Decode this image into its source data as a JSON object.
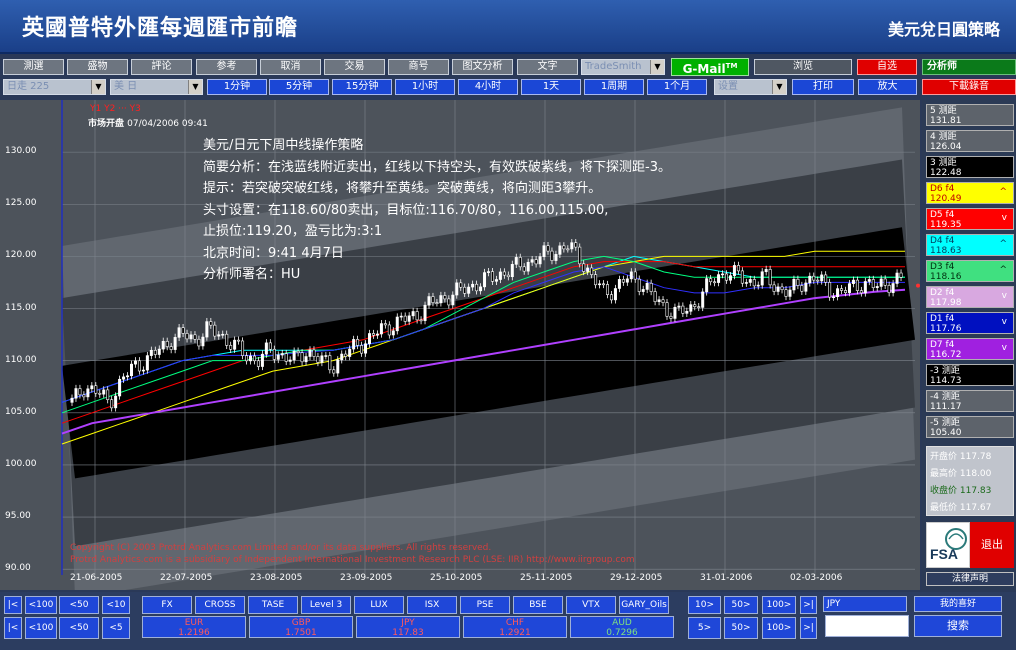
{
  "header": {
    "title": "英國普特外匯每週匯市前瞻",
    "subtitle": "美元兌日圓策略"
  },
  "toolbar1": {
    "buttons": [
      "測選",
      "盛物",
      "評论",
      "参考",
      "取消",
      "交易",
      "商号",
      "图文分析",
      "文字"
    ],
    "trade_select": "TradeSmith",
    "gmail": "G-Mail",
    "gmail_sup": "TM",
    "btn_browse": "浏览",
    "btn_auto": "自选",
    "analyst": "分析师"
  },
  "toolbar2": {
    "select1": "日走 225",
    "select2": "美 日",
    "intervals": [
      "1分钟",
      "5分钟",
      "15分钟",
      "1小时",
      "4小时",
      "1天",
      "1周期",
      "1个月"
    ],
    "select3": "设置",
    "print": "打印",
    "zoom": "放大",
    "download": "下載錄音"
  },
  "chart": {
    "legend_top": "Y1 Y2 ··· Y3",
    "open_time_label": "市场开盘",
    "open_time": "07/04/2006 09:41",
    "note_lines": [
      "美元/日元下周中线操作策略",
      "简要分析：在浅蓝线附近卖出，红线以下持空头，有效跌破紫线，将下探测距-3。",
      "提示：若突破突破红线，将攀升至黄线。突破黄线，将向测距3攀升。",
      "头寸设置：在118.60/80卖出，目标位:116.70/80，116.00,115.00,",
      "止损位:119.20，盈亏比为:3:1",
      "北京时间：9:41  4月7日",
      "分析师署名：HU"
    ],
    "copyright_1": "Copyright (C) 2003 Protrd Analytics.com Limited and/or its data suppliers.  All rights reserved.",
    "copyright_2": "Protrd Analytics.com is a subsidiary of Independent International Investment Research PLC (LSE: IIR) http://www.iirgroup.com"
  },
  "chart_data": {
    "type": "candlestick",
    "title": "",
    "xlabel": "",
    "ylabel": "",
    "ylim": [
      88,
      135
    ],
    "x_ticks": [
      "21-06-2005",
      "22-07-2005",
      "23-08-2005",
      "23-09-2005",
      "25-10-2005",
      "25-11-2005",
      "29-12-2005",
      "31-01-2006",
      "02-03-2006"
    ],
    "y_ticks": [
      "130.00",
      "125.00",
      "120.00",
      "115.00",
      "110.00",
      "105.00",
      "100.00",
      "95.00",
      "90.00"
    ],
    "y_values": [
      130,
      125,
      120,
      115,
      110,
      105,
      100,
      95,
      90
    ],
    "close_path": [
      106,
      107.5,
      107,
      106,
      108,
      109.5,
      110,
      111,
      112,
      112.5,
      112,
      113,
      112.5,
      111.5,
      110.5,
      110,
      111,
      110.5,
      110,
      111,
      110,
      109.5,
      110.5,
      111.5,
      112,
      113,
      113.5,
      114,
      114.5,
      115.5,
      116,
      116.5,
      117,
      117.5,
      118,
      118.5,
      119,
      119.5,
      120,
      120.5,
      121,
      120,
      118,
      116.5,
      117,
      118,
      117.5,
      116,
      115,
      114.5,
      115,
      116.5,
      118,
      118.5,
      118,
      117.5,
      118,
      117,
      116.5,
      117.5,
      118,
      117,
      116.5,
      117,
      117.5,
      117,
      117.5,
      117.8
    ],
    "ma_lines": [
      {
        "color": "#00ffff",
        "values": [
          106,
          107,
          108,
          109,
          110,
          110.5,
          111,
          111,
          111,
          111,
          111.5,
          112,
          113,
          114,
          115,
          116,
          117,
          118,
          119,
          120,
          119.5,
          119,
          118.5,
          118,
          118,
          118,
          118,
          118,
          118
        ]
      },
      {
        "color": "#ff0000",
        "values": [
          104,
          105,
          106,
          107,
          108,
          109,
          110,
          110.5,
          111,
          111.5,
          112,
          113,
          114,
          115,
          116,
          117,
          118,
          119,
          119.5,
          119.5,
          119.5,
          119,
          119,
          119,
          119,
          119,
          119,
          119,
          119
        ]
      },
      {
        "color": "#ffff00",
        "values": [
          102,
          103,
          104,
          105,
          106,
          107,
          108,
          109,
          109.5,
          110,
          111,
          112,
          113,
          114,
          115,
          116,
          117,
          118,
          119,
          119.5,
          120,
          120,
          120,
          120,
          120,
          120.5,
          120.5,
          120.5,
          120.5
        ]
      },
      {
        "color": "#00ff80",
        "values": [
          105,
          106,
          107,
          108,
          109,
          110,
          110,
          110.5,
          111,
          111,
          111.5,
          112,
          113,
          114.5,
          116,
          117.5,
          118.5,
          119.5,
          120,
          119.5,
          118.5,
          118,
          118,
          118,
          118,
          118,
          118,
          118,
          118
        ]
      },
      {
        "color": "#3030ff",
        "values": [
          106,
          107,
          108,
          109,
          110,
          110.5,
          110.5,
          110.5,
          110.8,
          111,
          111.5,
          112,
          113,
          114,
          115,
          116.5,
          117.5,
          118.5,
          119,
          118,
          117,
          116.5,
          116.5,
          117,
          117,
          117.5,
          117.5,
          117.5,
          117.5
        ]
      },
      {
        "color": "#b040ff",
        "values": [
          103,
          104,
          104.5,
          105,
          105.5,
          106,
          106.5,
          107,
          107.5,
          108,
          108.5,
          109,
          109.5,
          110,
          110.5,
          111,
          111.5,
          112,
          112.5,
          113,
          113.5,
          114,
          114.5,
          115,
          115.5,
          116,
          116.3,
          116.6,
          116.8
        ]
      }
    ],
    "levels": [
      {
        "label": "5 测距",
        "value": "131.81",
        "bg": "#5d636b",
        "fg": "#ffffff",
        "mark": ""
      },
      {
        "label": "4 测距",
        "value": "126.04",
        "bg": "#5d636b",
        "fg": "#ffffff",
        "mark": ""
      },
      {
        "label": "3 测距",
        "value": "122.48",
        "bg": "#000000",
        "fg": "#ffffff",
        "mark": ""
      },
      {
        "label": "D6 f4",
        "value": "120.49",
        "bg": "#ffff00",
        "fg": "#c00000",
        "mark": "^"
      },
      {
        "label": "D5 f4",
        "value": "119.35",
        "bg": "#ff0000",
        "fg": "#ffffff",
        "mark": "v"
      },
      {
        "label": "D4 f4",
        "value": "118.63",
        "bg": "#00ffff",
        "fg": "#004060",
        "mark": "^"
      },
      {
        "label": "D3 f4",
        "value": "118.16",
        "bg": "#40e080",
        "fg": "#003010",
        "mark": "^"
      },
      {
        "label": "D2 f4",
        "value": "117.98",
        "bg": "#d8a8e0",
        "fg": "#ffffff",
        "mark": "v"
      },
      {
        "label": "D1 f4",
        "value": "117.76",
        "bg": "#0010c0",
        "fg": "#ffffff",
        "mark": "v"
      },
      {
        "label": "D7 f4",
        "value": "116.72",
        "bg": "#a020e0",
        "fg": "#ffffff",
        "mark": "v"
      },
      {
        "label": "-3 测距",
        "value": "114.73",
        "bg": "#000000",
        "fg": "#ffffff",
        "mark": ""
      },
      {
        "label": "-4 测距",
        "value": "111.17",
        "bg": "#5d636b",
        "fg": "#ffffff",
        "mark": ""
      },
      {
        "label": "-5 测距",
        "value": "105.40",
        "bg": "#5d636b",
        "fg": "#ffffff",
        "mark": ""
      }
    ]
  },
  "prices": {
    "open_label": "开盘价",
    "open": "117.78",
    "high_label": "最高价",
    "high": "118.00",
    "close_label": "收盘价",
    "close": "117.83",
    "low_label": "最低价",
    "low": "117.67"
  },
  "side": {
    "exit": "退出",
    "legal": "法律声明",
    "fsa": "FSA"
  },
  "bottom": {
    "nav_row1": [
      "|<",
      "<100",
      "<50",
      "<10"
    ],
    "nav_row2": [
      "|<",
      "<100",
      "<50",
      "<5"
    ],
    "instruments": [
      "FX",
      "CROSS",
      "TASE",
      "Level 3",
      "LUX",
      "ISX",
      "PSE",
      "BSE",
      "VTX",
      "GARY_Oils"
    ],
    "quotes": [
      {
        "sym": "EUR",
        "val": "1.2196",
        "color": "red"
      },
      {
        "sym": "GBP",
        "val": "1.7501",
        "color": "red"
      },
      {
        "sym": "JPY",
        "val": "117.83",
        "color": "red"
      },
      {
        "sym": "CHF",
        "val": "1.2921",
        "color": "red"
      },
      {
        "sym": "AUD",
        "val": "0.7296",
        "color": "green"
      }
    ],
    "fwd_row1": [
      "10>",
      "50>",
      "100>",
      ">|"
    ],
    "fwd_row2": [
      "5>",
      "50>",
      "100>",
      ">|"
    ],
    "symbol": "JPY",
    "favorites": "我的喜好",
    "search": "搜索"
  }
}
